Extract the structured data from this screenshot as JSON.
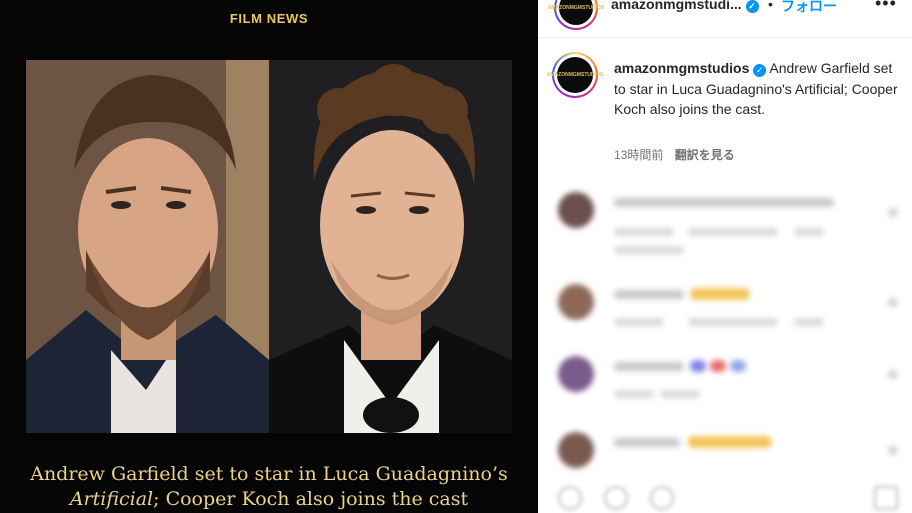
{
  "media": {
    "kicker": "FILM NEWS",
    "headline_part1": "Andrew Garfield set to star in Luca Guadagnino’s",
    "headline_italic": "Artificial",
    "headline_part2": "; Cooper Koch also joins the cast"
  },
  "header": {
    "username": "amazonmgmstudi...",
    "verified_glyph": "✓",
    "separator": "•",
    "follow_label": "フォロー",
    "more_glyph": "•••",
    "avatar_lines": [
      "AMAZON",
      "MGM",
      "STUDIOS"
    ]
  },
  "caption": {
    "username": "amazonmgmstudios",
    "verified_glyph": "✓",
    "text": "Andrew Garfield set to star in Luca Guadagnino's Artificial; Cooper Koch also joins the cast.",
    "time": "13時間前",
    "translate_label": "翻訳を見る"
  },
  "colors": {
    "accent_gold": "#e8c766",
    "link_blue": "#0095f6",
    "panel_bg": "#050505"
  }
}
